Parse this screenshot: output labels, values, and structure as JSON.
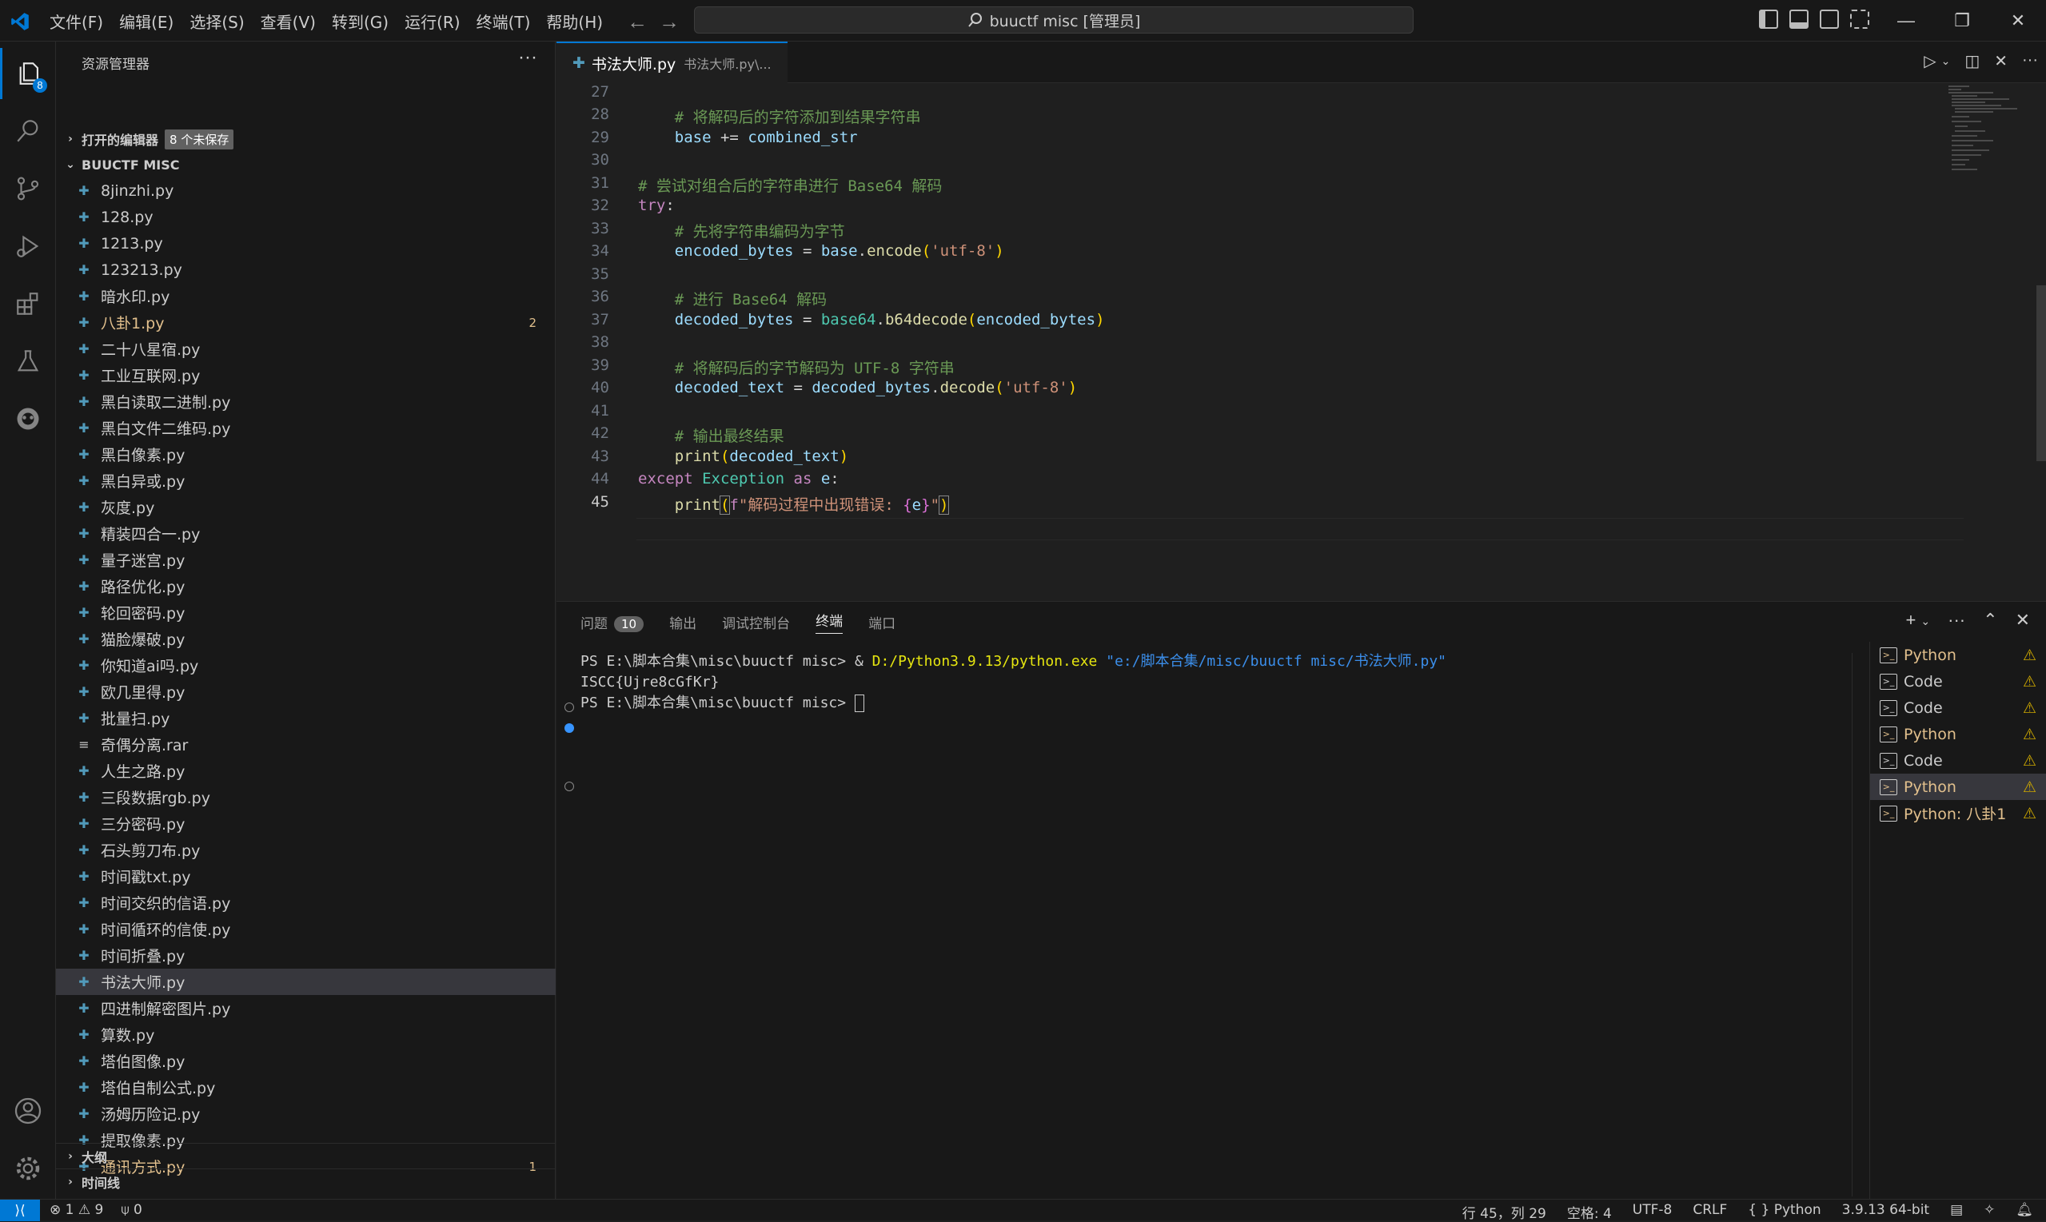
{
  "menu": [
    "文件(F)",
    "编辑(E)",
    "选择(S)",
    "查看(V)",
    "转到(G)",
    "运行(R)",
    "终端(T)",
    "帮助(H)"
  ],
  "command_center": "buuctf misc [管理员]",
  "activity": {
    "explorer_badge": "8"
  },
  "sidebar": {
    "title": "资源管理器",
    "open_editors": "打开的编辑器",
    "unsaved": "8 个未保存",
    "folder": "BUUCTF MISC",
    "outline": "大纲",
    "timeline": "时间线",
    "files": [
      {
        "name": "8jinzhi.py",
        "count": ""
      },
      {
        "name": "128.py",
        "count": ""
      },
      {
        "name": "1213.py",
        "count": ""
      },
      {
        "name": "123213.py",
        "count": ""
      },
      {
        "name": "暗水印.py",
        "count": ""
      },
      {
        "name": "八卦1.py",
        "count": "2"
      },
      {
        "name": "二十八星宿.py",
        "count": ""
      },
      {
        "name": "工业互联网.py",
        "count": ""
      },
      {
        "name": "黑白读取二进制.py",
        "count": ""
      },
      {
        "name": "黑白文件二维码.py",
        "count": ""
      },
      {
        "name": "黑白像素.py",
        "count": ""
      },
      {
        "name": "黑白异或.py",
        "count": ""
      },
      {
        "name": "灰度.py",
        "count": ""
      },
      {
        "name": "精装四合一.py",
        "count": ""
      },
      {
        "name": "量子迷宫.py",
        "count": ""
      },
      {
        "name": "路径优化.py",
        "count": ""
      },
      {
        "name": "轮回密码.py",
        "count": ""
      },
      {
        "name": "猫脸爆破.py",
        "count": ""
      },
      {
        "name": "你知道ai吗.py",
        "count": ""
      },
      {
        "name": "欧几里得.py",
        "count": ""
      },
      {
        "name": "批量扫.py",
        "count": ""
      },
      {
        "name": "奇偶分离.rar",
        "count": ""
      },
      {
        "name": "人生之路.py",
        "count": ""
      },
      {
        "name": "三段数据rgb.py",
        "count": ""
      },
      {
        "name": "三分密码.py",
        "count": ""
      },
      {
        "name": "石头剪刀布.py",
        "count": ""
      },
      {
        "name": "时间戳txt.py",
        "count": ""
      },
      {
        "name": "时间交织的信语.py",
        "count": ""
      },
      {
        "name": "时间循环的信使.py",
        "count": ""
      },
      {
        "name": "时间折叠.py",
        "count": ""
      },
      {
        "name": "书法大师.py",
        "count": ""
      },
      {
        "name": "四进制解密图片.py",
        "count": ""
      },
      {
        "name": "算数.py",
        "count": ""
      },
      {
        "name": "塔伯图像.py",
        "count": ""
      },
      {
        "name": "塔伯自制公式.py",
        "count": ""
      },
      {
        "name": "汤姆历险记.py",
        "count": ""
      },
      {
        "name": "提取像素.py",
        "count": ""
      },
      {
        "name": "通讯方式.py",
        "count": "1"
      }
    ]
  },
  "editor": {
    "tab_name": "书法大师.py",
    "tab_desc": "书法大师.py\\...",
    "lines": [
      "27",
      "28",
      "29",
      "30",
      "31",
      "32",
      "33",
      "34",
      "35",
      "36",
      "37",
      "38",
      "39",
      "40",
      "41",
      "42",
      "43",
      "44",
      "45"
    ]
  },
  "panel": {
    "tabs": {
      "problems": "问题",
      "problems_count": "10",
      "output": "输出",
      "debug": "调试控制台",
      "terminal": "终端",
      "ports": "端口"
    },
    "term_prompt": "PS E:\\脚本合集\\misc\\buuctf misc> ",
    "term_cmd_amp": "& ",
    "term_cmd_exe": "D:/Python3.9.13/python.exe",
    "term_cmd_arg": " \"e:/脚本合集/misc/buuctf misc/书法大师.py\"",
    "term_output": "ISCC{Ujre8cGfKr}",
    "term_prompt2": "PS E:\\脚本合集\\misc\\buuctf misc> ",
    "terminals": [
      "Python",
      "Code",
      "Code",
      "Python",
      "Code",
      "Python",
      "Python: 八卦1"
    ]
  },
  "status": {
    "errors": "1",
    "warnings": "9",
    "ports": "0",
    "position": "行 45，列 29",
    "spaces": "空格: 4",
    "encoding": "UTF-8",
    "eol": "CRLF",
    "language": "Python",
    "interpreter": "3.9.13 64-bit"
  }
}
